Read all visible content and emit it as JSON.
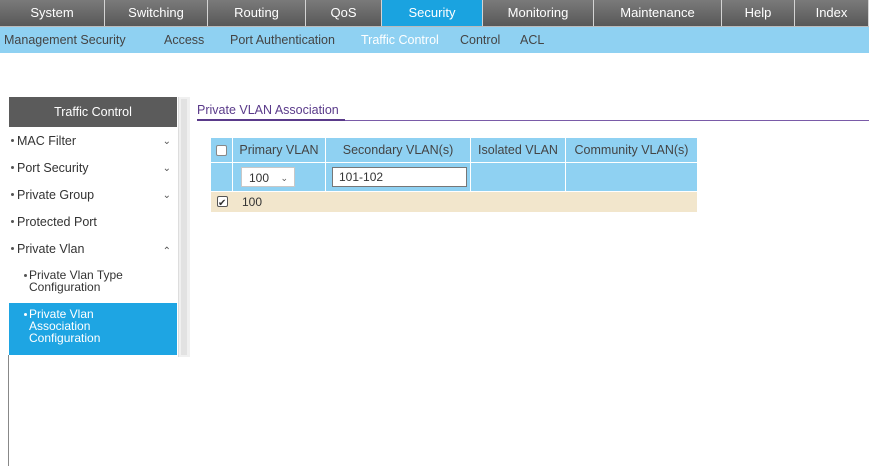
{
  "top_nav": {
    "tabs": [
      "System",
      "Switching",
      "Routing",
      "QoS",
      "Security",
      "Monitoring",
      "Maintenance",
      "Help",
      "Index"
    ],
    "active": "Security"
  },
  "sub_nav": {
    "tabs": [
      "Management Security",
      "Access",
      "Port Authentication",
      "Traffic Control",
      "Control",
      "ACL"
    ],
    "active": "Traffic Control"
  },
  "sidebar": {
    "title": "Traffic Control",
    "items": [
      {
        "label": "MAC Filter",
        "chevron": "chevron-down-icon"
      },
      {
        "label": "Port Security",
        "chevron": "chevron-down-icon"
      },
      {
        "label": "Private Group",
        "chevron": "chevron-down-icon"
      },
      {
        "label": "Protected Port",
        "chevron": ""
      },
      {
        "label": "Private Vlan",
        "chevron": "chevron-up-icon"
      }
    ],
    "subitems": [
      {
        "label": "Private Vlan Type Configuration",
        "active": false
      },
      {
        "label": "Private Vlan Association Configuration",
        "active": true
      }
    ]
  },
  "content": {
    "section_title": "Private VLAN Association",
    "table": {
      "headers": [
        "",
        "Primary VLAN",
        "Secondary VLAN(s)",
        "Isolated VLAN",
        "Community VLAN(s)"
      ],
      "edit_row": {
        "primary_select": "100",
        "secondary_input": "101-102"
      },
      "rows": [
        {
          "checked": true,
          "primary_vlan": "100",
          "secondary_vlans": "",
          "isolated_vlan": "",
          "community_vlans": ""
        }
      ]
    }
  },
  "colors": {
    "accent_blue": "#1aa3e0",
    "subnav_blue": "#8fd1f2",
    "row_beige": "#f2e6cc",
    "title_purple": "#5a3a8a"
  }
}
